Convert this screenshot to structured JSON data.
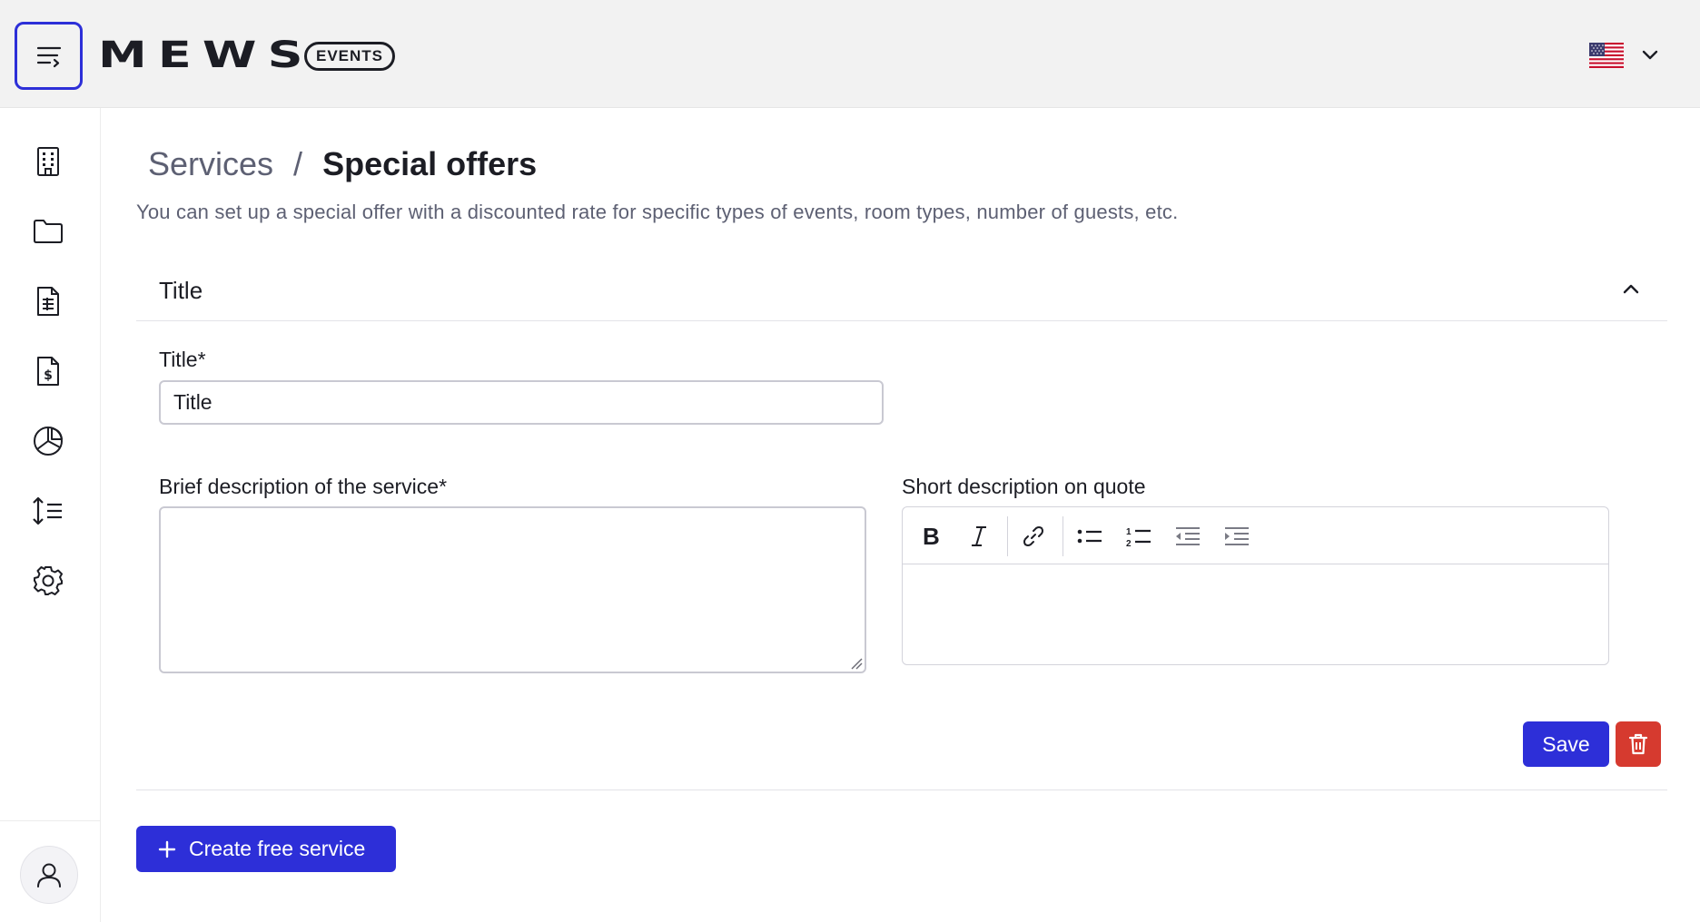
{
  "header": {
    "logo_text": "MEWS",
    "badge": "EVENTS",
    "language_flag": "us-flag-icon"
  },
  "sidebar": {
    "items": [
      {
        "icon": "building-icon"
      },
      {
        "icon": "folder-icon"
      },
      {
        "icon": "document-list-icon"
      },
      {
        "icon": "invoice-dollar-icon"
      },
      {
        "icon": "pie-chart-icon"
      },
      {
        "icon": "sort-lines-icon"
      },
      {
        "icon": "gear-icon"
      }
    ],
    "profile_icon": "user-icon"
  },
  "breadcrumb": {
    "parent": "Services",
    "separator": "/",
    "current": "Special offers"
  },
  "subtitle": "You can set up a special offer with a discounted rate for specific types of events, room types, number of guests, etc.",
  "section": {
    "title": "Title"
  },
  "form": {
    "title_label": "Title*",
    "title_value": "Title",
    "brief_label": "Brief description of the service*",
    "brief_value": "",
    "quote_label": "Short description on quote",
    "toolbar": [
      "bold",
      "italic",
      "link",
      "bulleted-list",
      "numbered-list",
      "outdent",
      "indent"
    ]
  },
  "actions": {
    "save_label": "Save",
    "create_label": "Create free service"
  },
  "colors": {
    "accent": "#2d2fd8",
    "danger": "#d63a2f"
  }
}
